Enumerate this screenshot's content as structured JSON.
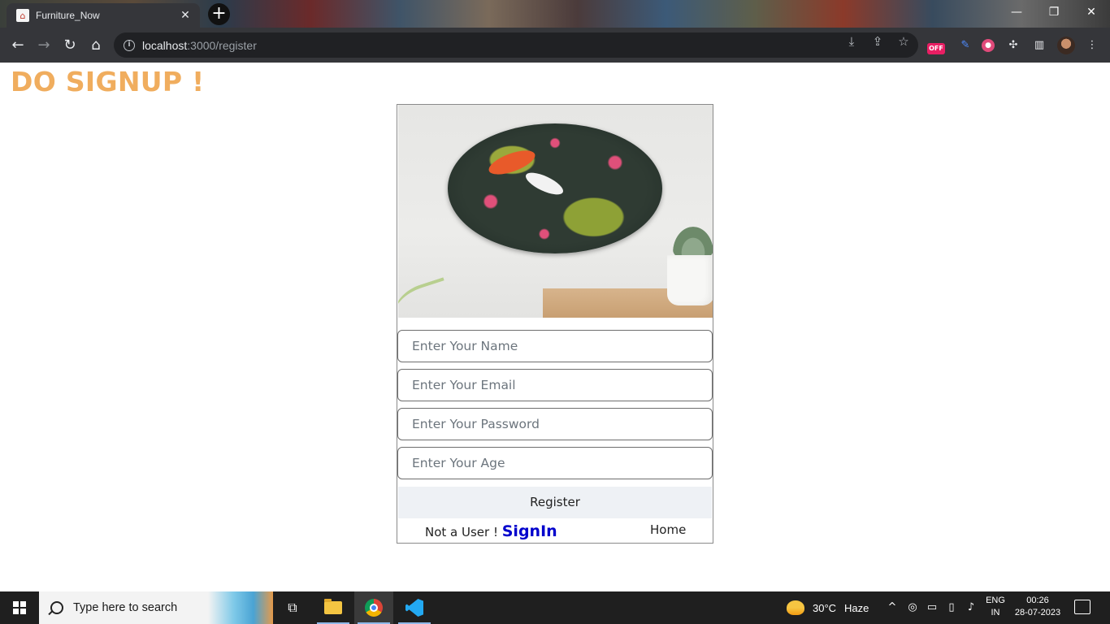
{
  "browser": {
    "tab_title": "Furniture_Now",
    "url_host": "localhost",
    "url_path": ":3000/register",
    "extensions": [
      "OFF"
    ]
  },
  "page": {
    "heading": "DO SIGNUP !",
    "heading_color": "#f0ad5e",
    "form": {
      "name_placeholder": "Enter Your Name",
      "email_placeholder": "Enter Your Email",
      "password_placeholder": "Enter Your Password",
      "age_placeholder": "Enter Your Age",
      "register_label": "Register"
    },
    "footer": {
      "prompt": "Not a User ! ",
      "signin_label": "SignIn",
      "home_label": "Home",
      "link_color": "#0000cc"
    }
  },
  "taskbar": {
    "search_placeholder": "Type here to search",
    "weather_temp": "30°C",
    "weather_condition": "Haze",
    "lang_line1": "ENG",
    "lang_line2": "IN",
    "time": "00:26",
    "date": "28-07-2023"
  }
}
